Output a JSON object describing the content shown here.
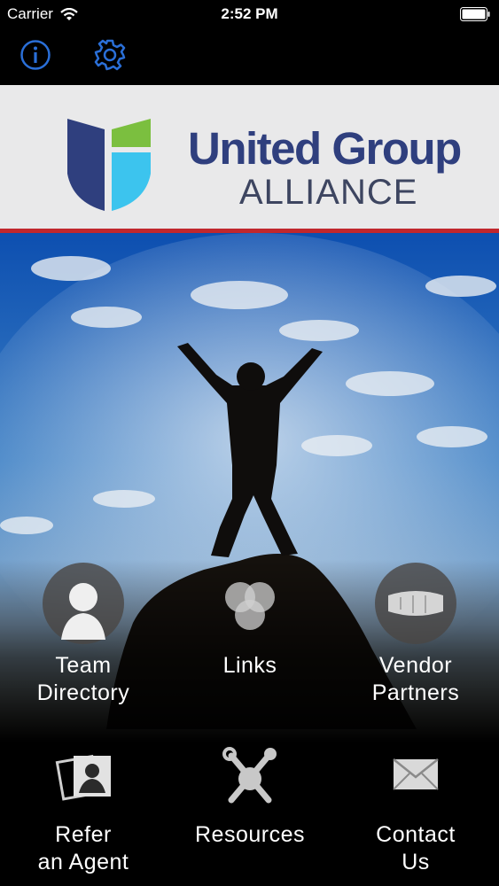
{
  "status_bar": {
    "carrier": "Carrier",
    "time": "2:52 PM"
  },
  "toolbar": {
    "info_icon": "info-icon",
    "settings_icon": "gear-icon"
  },
  "brand": {
    "title": "United Group",
    "subtitle": "ALLIANCE",
    "colors": {
      "navy": "#2f3f7e",
      "green": "#7bbf3f",
      "cyan": "#3cc4ee",
      "red": "#c1272d"
    }
  },
  "menu": [
    {
      "line1": "Team",
      "line2": "Directory",
      "icon": "person-icon"
    },
    {
      "line1": "Links",
      "line2": "",
      "icon": "links-icon"
    },
    {
      "line1": "Vendor",
      "line2": "Partners",
      "icon": "handshake-icon"
    },
    {
      "line1": "Refer",
      "line2": "an Agent",
      "icon": "photo-cards-icon"
    },
    {
      "line1": "Resources",
      "line2": "",
      "icon": "tools-icon"
    },
    {
      "line1": "Contact",
      "line2": "Us",
      "icon": "envelope-icon"
    }
  ]
}
